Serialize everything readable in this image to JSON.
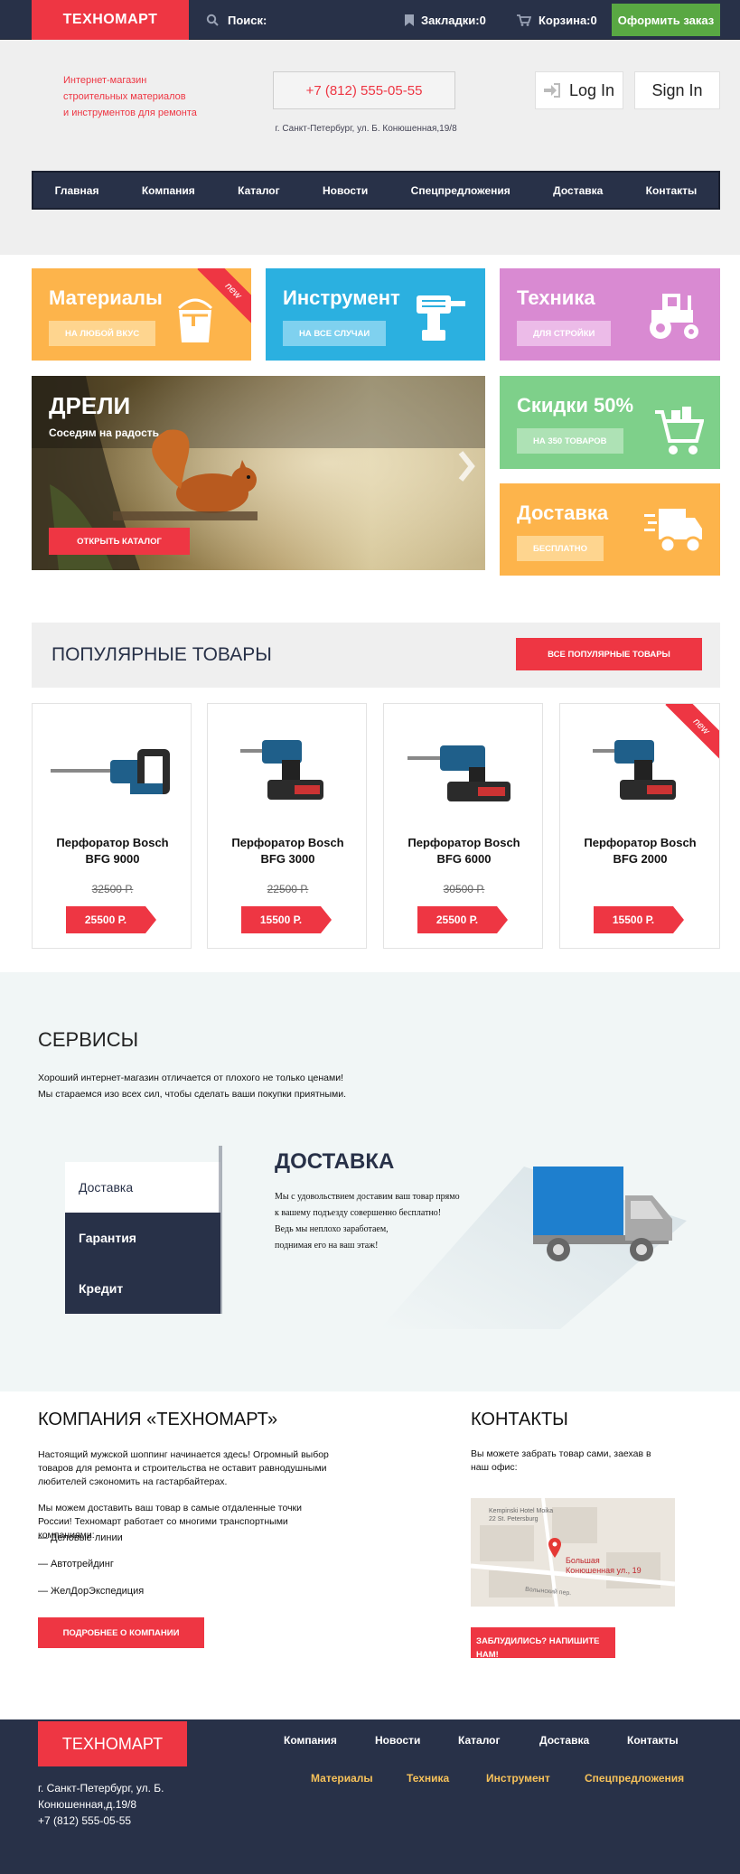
{
  "topbar": {
    "logo": "ТЕХНОМАРТ",
    "search_label": "Поиск:",
    "bookmarks": "Закладки:0",
    "cart": "Корзина:0",
    "order_button": "Оформить заказ"
  },
  "header": {
    "tagline_1": "Интернет-магазин",
    "tagline_2": "строительных материалов",
    "tagline_3": "и инструментов для ремонта",
    "phone": "+7 (812) 555-05-55",
    "address": "г. Санкт-Петербург, ул. Б. Конюшенная,19/8",
    "login": "Log In",
    "signin": "Sign In"
  },
  "nav": [
    "Главная",
    "Компания",
    "Каталог",
    "Новости",
    "Спецпредложения",
    "Доставка",
    "Контакты"
  ],
  "tiles": {
    "materials": {
      "title": "Материалы",
      "button": "НА ЛЮБОЙ ВКУС",
      "ribbon": "new",
      "color": "#fdb44b"
    },
    "tools": {
      "title": "Инструмент",
      "button": "НА ВСЕ СЛУЧАИ",
      "color": "#2bb0e0"
    },
    "tech": {
      "title": "Техника",
      "button": "ДЛЯ СТРОЙКИ",
      "color": "#d98ad2"
    },
    "discount": {
      "title": "Скидки 50%",
      "button": "НА 350 ТОВАРОВ",
      "color": "#7ed08a"
    },
    "delivery": {
      "title": "Доставка",
      "button": "БЕСПЛАТНО",
      "color": "#fdb44b"
    }
  },
  "hero": {
    "title": "ДРЕЛИ",
    "subtitle": "Соседям на радость",
    "button": "ОТКРЫТЬ КАТАЛОГ"
  },
  "popular": {
    "title": "ПОПУЛЯРНЫЕ ТОВАРЫ",
    "button": "ВСЕ ПОПУЛЯРНЫЕ ТОВАРЫ",
    "products": [
      {
        "name_1": "Перфоратор Bosch",
        "name_2": "BFG 9000",
        "old_price": "32500 Р.",
        "price": "25500 Р."
      },
      {
        "name_1": "Перфоратор Bosch",
        "name_2": "BFG 3000",
        "old_price": "22500 Р.",
        "price": "15500 Р."
      },
      {
        "name_1": "Перфоратор Bosch",
        "name_2": "BFG 6000",
        "old_price": "30500 Р.",
        "price": "25500 Р."
      },
      {
        "name_1": "Перфоратор Bosch",
        "name_2": "BFG 2000",
        "old_price": "",
        "price": "15500 Р.",
        "ribbon": "new"
      }
    ]
  },
  "services": {
    "title": "СЕРВИСЫ",
    "text_1": "Хороший интернет-магазин отличается от плохого не только ценами!",
    "text_2": "Мы стараемся изо всех сил, чтобы сделать ваши покупки приятными.",
    "tabs": [
      "Доставка",
      "Гарантия",
      "Кредит"
    ],
    "active_heading": "ДОСТАВКА",
    "desc_1": "Мы с удовольствием доставим ваш товар прямо",
    "desc_2": "к вашему подъезду совершенно бесплатно!",
    "desc_3": "Ведь мы неплохо заработаем,",
    "desc_4": "поднимая его на ваш этаж!"
  },
  "company": {
    "title": "КОМПАНИЯ «ТЕХНОМАРТ»",
    "p1": "Настоящий мужской шоппинг начинается здесь! Огромный выбор товаров для ремонта и строительства не оставит равнодушными любителей сэкономить на гастарбайтерах.",
    "p2": "Мы можем доставить ваш товар в самые отдаленные точки России! Техномарт работает со многими транспортными компаниями:",
    "list": [
      "— Деловые линии",
      "— Автотрейдинг",
      "— ЖелДорЭкспедиция"
    ],
    "button": "ПОДРОБНЕЕ О КОМПАНИИ"
  },
  "contacts": {
    "title": "КОНТАКТЫ",
    "text": "Вы можете забрать товар сами, заехав в наш офис:",
    "map_label_1": "Kempinski Hotel Moika",
    "map_label_2": "22 St. Petersburg",
    "map_pin_1": "Большая",
    "map_pin_2": "Конюшенная ул., 19",
    "map_street": "Волынский пер.",
    "button": "ЗАБЛУДИЛИСЬ? НАПИШИТЕ НАМ!"
  },
  "footer": {
    "logo": "ТЕХНОМАРТ",
    "address_1": "г. Санкт-Петербург, ул. Б.",
    "address_2": "Конюшенная,д.19/8",
    "phone": "+7 (812) 555-05-55",
    "nav_1": [
      "Компания",
      "Новости",
      "Каталог",
      "Доставка",
      "Контакты"
    ],
    "nav_2": [
      "Материалы",
      "Техника",
      "Инструмент",
      "Спецпредложения"
    ]
  }
}
